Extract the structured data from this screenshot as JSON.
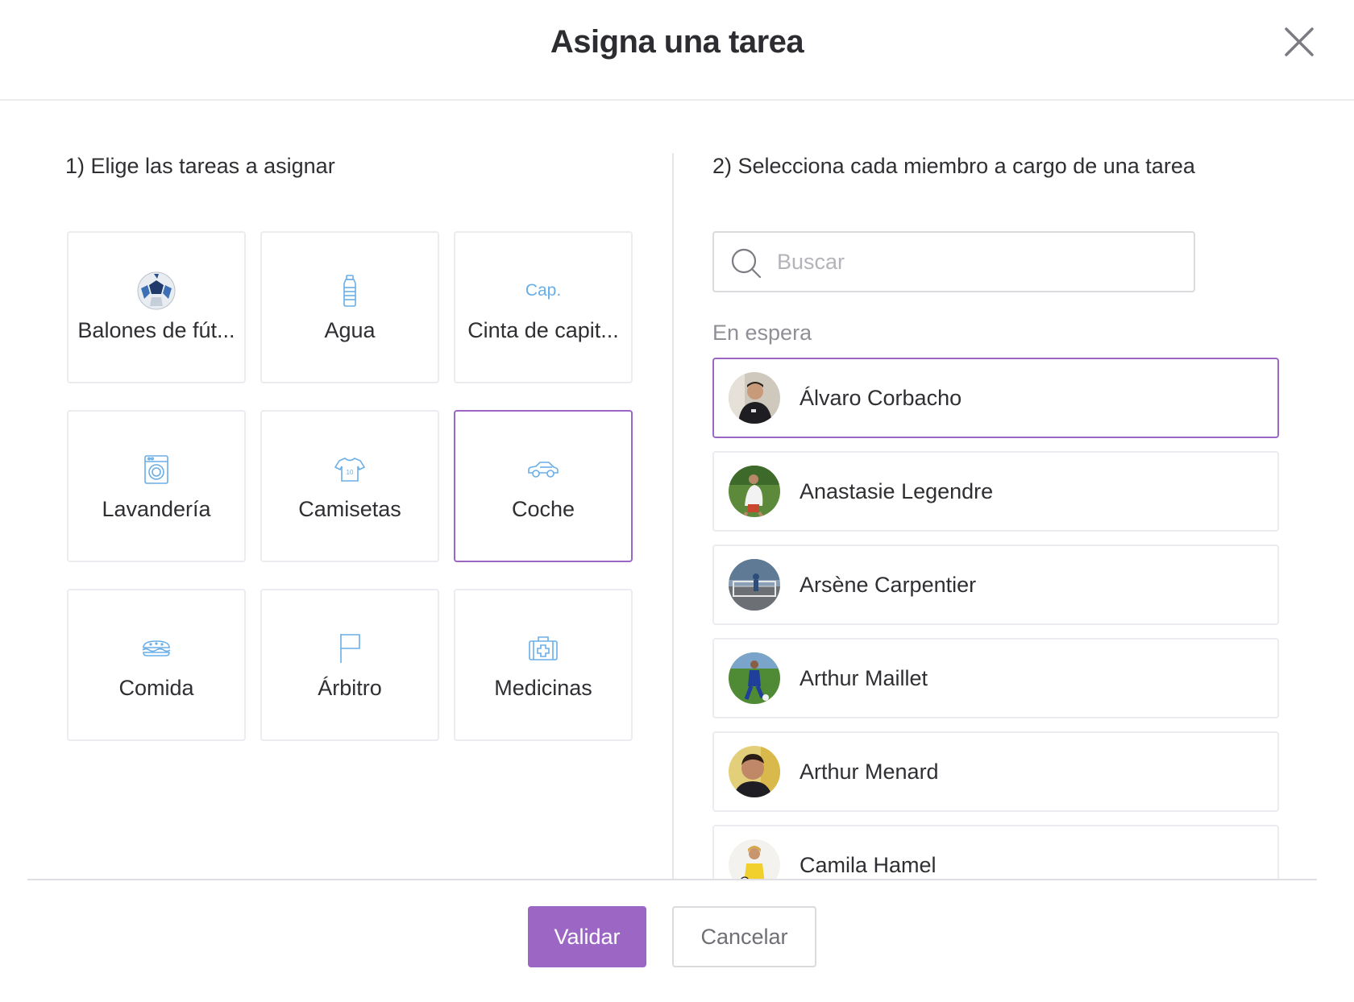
{
  "header": {
    "title": "Asigna una tarea",
    "close_icon": "close-icon"
  },
  "left": {
    "title": "1) Elige las tareas a asignar",
    "tasks": [
      {
        "label": "Balones de fút...",
        "icon": "soccer-ball-icon",
        "selected": false
      },
      {
        "label": "Agua",
        "icon": "water-bottle-icon",
        "selected": false
      },
      {
        "label": "Cinta de capit...",
        "icon": "captain-armband-icon",
        "icon_text": "Cap.",
        "selected": false
      },
      {
        "label": "Lavandería",
        "icon": "washing-machine-icon",
        "selected": false
      },
      {
        "label": "Camisetas",
        "icon": "jersey-icon",
        "selected": false
      },
      {
        "label": "Coche",
        "icon": "car-icon",
        "selected": true
      },
      {
        "label": "Comida",
        "icon": "sandwich-icon",
        "selected": false
      },
      {
        "label": "Árbitro",
        "icon": "flag-icon",
        "selected": false
      },
      {
        "label": "Medicinas",
        "icon": "first-aid-kit-icon",
        "selected": false
      }
    ]
  },
  "right": {
    "title": "2) Selecciona cada miembro a cargo de una tarea",
    "search": {
      "placeholder": "Buscar",
      "value": ""
    },
    "group_label": "En espera",
    "members": [
      {
        "name": "Álvaro Corbacho",
        "selected": true
      },
      {
        "name": "Anastasie Legendre",
        "selected": false
      },
      {
        "name": "Arsène Carpentier",
        "selected": false
      },
      {
        "name": "Arthur Maillet",
        "selected": false
      },
      {
        "name": "Arthur Menard",
        "selected": false
      },
      {
        "name": "Camila Hamel",
        "selected": false
      }
    ]
  },
  "footer": {
    "validate_label": "Validar",
    "cancel_label": "Cancelar"
  },
  "colors": {
    "accent": "#9b66c4",
    "icon_blue": "#6aaee6",
    "border": "#ececf0",
    "muted_text": "#8f8f96"
  }
}
